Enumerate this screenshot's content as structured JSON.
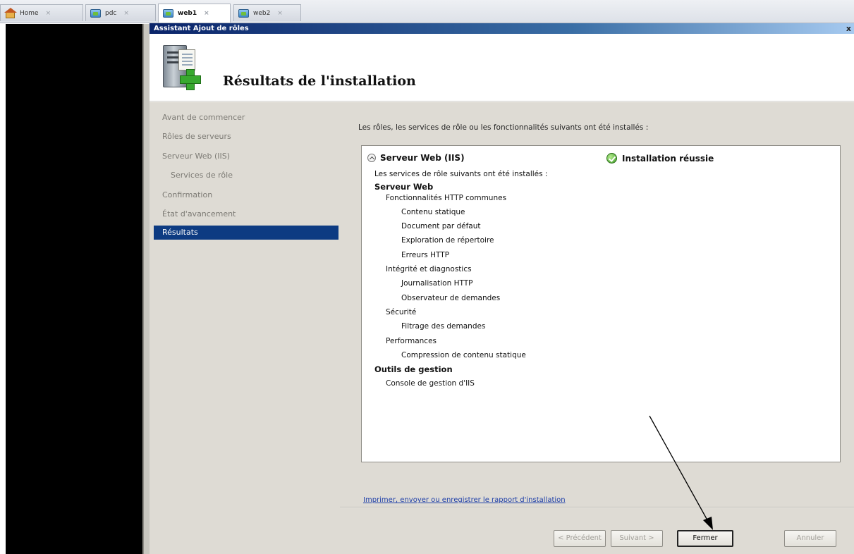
{
  "tabs": [
    {
      "label": "Home",
      "icon": "home-icon"
    },
    {
      "label": "pdc",
      "icon": "vm-icon"
    },
    {
      "label": "web1",
      "icon": "vm-icon",
      "active": true
    },
    {
      "label": "web2",
      "icon": "vm-icon"
    }
  ],
  "tab_close_glyph": "×",
  "dialog": {
    "title": "Assistant Ajout de rôles",
    "close_glyph": "x",
    "header_title": "Résultats de l'installation"
  },
  "nav": {
    "items": [
      "Avant de commencer",
      "Rôles de serveurs",
      "Serveur Web (IIS)",
      "Services de rôle",
      "Confirmation",
      "État d'avancement",
      "Résultats"
    ],
    "selected_index": 6
  },
  "content": {
    "intro": "Les rôles, les services de rôle ou les fonctionnalités suivants ont été installés :",
    "result": {
      "role": "Serveur Web (IIS)",
      "status": "Installation réussie",
      "lines": [
        "Les services de rôle suivants ont été installés :",
        "Serveur Web",
        "Fonctionnalités HTTP communes",
        "Contenu statique",
        "Document par défaut",
        "Exploration de répertoire",
        "Erreurs HTTP",
        "Intégrité et diagnostics",
        "Journalisation HTTP",
        "Observateur de demandes",
        "Sécurité",
        "Filtrage des demandes",
        "Performances",
        "Compression de contenu statique",
        "Outils de gestion",
        "Console de gestion d'IIS"
      ]
    },
    "report_link": "Imprimer, envoyer ou enregistrer le rapport d'installation"
  },
  "buttons": {
    "previous": "< Précédent",
    "next": "Suivant >",
    "close": "Fermer",
    "cancel": "Annuler"
  },
  "colors": {
    "nav_selected": "#0d3b82",
    "link": "#1d3ea8",
    "success": "#3c9a25"
  }
}
